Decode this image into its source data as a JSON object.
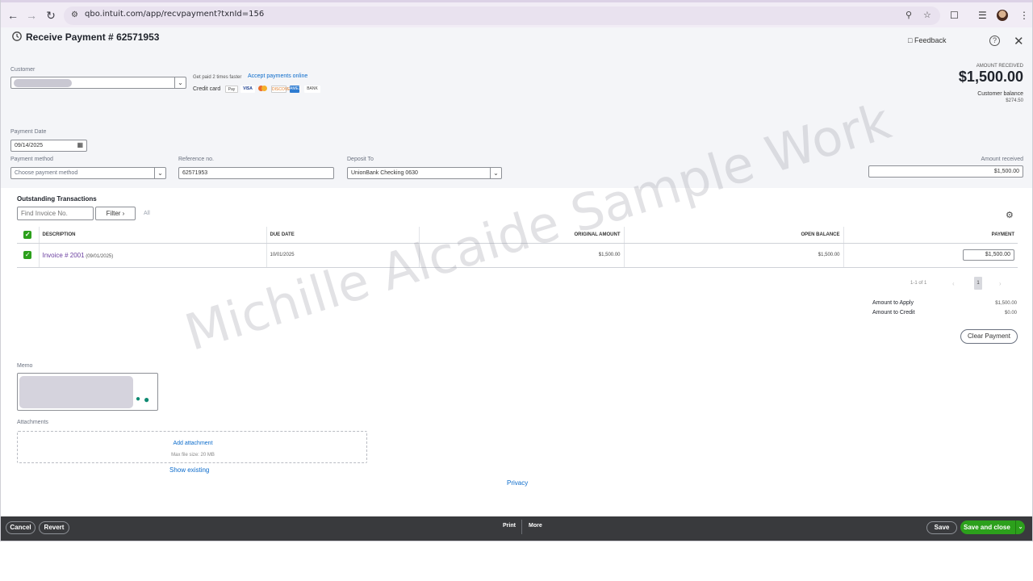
{
  "browser": {
    "url": "qbo.intuit.com/app/recvpayment?txnId=156"
  },
  "header": {
    "title": "Receive Payment # 62571953",
    "feedback_label": "Feedback"
  },
  "customer": {
    "label": "Customer",
    "getpaid_text": "Get paid 2 times faster",
    "accept_link": "Accept payments online",
    "credit_card_label": "Credit card",
    "cards": [
      "Pay",
      "VISA",
      "MC",
      "DISCOVER",
      "AMEX",
      "BANK"
    ]
  },
  "amount_summary": {
    "label": "AMOUNT RECEIVED",
    "amount": "$1,500.00",
    "customer_balance_label": "Customer balance",
    "customer_balance": "$274.50"
  },
  "payment": {
    "date_label": "Payment Date",
    "date_value": "09/14/2025",
    "method_label": "Payment method",
    "method_placeholder": "Choose payment method",
    "reference_label": "Reference no.",
    "reference_value": "62571953",
    "deposit_label": "Deposit To",
    "deposit_value": "UnionBank Checking 0630",
    "amount_received_label": "Amount received",
    "amount_received_value": "$1,500.00"
  },
  "outstanding": {
    "title": "Outstanding Transactions",
    "find_placeholder": "Find Invoice No.",
    "filter_label": "Filter",
    "all_label": "All",
    "columns": [
      "DESCRIPTION",
      "DUE DATE",
      "ORIGINAL AMOUNT",
      "OPEN BALANCE",
      "PAYMENT"
    ],
    "rows": [
      {
        "invoice": "Invoice # 2001",
        "invoice_date": "(09/01/2025)",
        "due_date": "10/01/2025",
        "original_amount": "$1,500.00",
        "open_balance": "$1,500.00",
        "payment": "$1,500.00"
      }
    ],
    "pager_text": "1-1 of 1",
    "page_number": "1",
    "amount_to_apply_label": "Amount to Apply",
    "amount_to_apply": "$1,500.00",
    "amount_to_credit_label": "Amount to Credit",
    "amount_to_credit": "$0.00",
    "clear_payment_label": "Clear Payment"
  },
  "memo": {
    "label": "Memo"
  },
  "attachments": {
    "label": "Attachments",
    "add_label": "Add attachment",
    "max_size": "Max file size: 20 MB",
    "show_existing": "Show existing"
  },
  "privacy_label": "Privacy",
  "watermark": "Michille Alcaide Sample Work",
  "footer": {
    "cancel": "Cancel",
    "revert": "Revert",
    "print": "Print",
    "more": "More",
    "save": "Save",
    "save_and_close": "Save and close"
  },
  "colors": {
    "accent_green": "#2ca01c",
    "link_blue": "#0b6bcb",
    "footer_bg": "#393a3d"
  }
}
